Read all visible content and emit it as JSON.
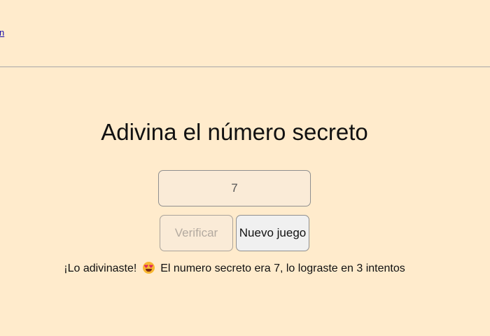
{
  "header": {
    "link_label": "n"
  },
  "main": {
    "title": "Adivina el número secreto",
    "input": {
      "value": "7",
      "placeholder": ""
    },
    "buttons": {
      "verify_label": "Verificar",
      "new_game_label": "Nuevo juego"
    },
    "result": {
      "prefix": "¡Lo adivinaste!",
      "emoji": "star-struck-face-icon",
      "suffix": "El numero secreto era 7, lo lograste en 3 intentos"
    }
  },
  "colors": {
    "background": "#ffebcc",
    "input_background": "#faebd7",
    "button_background": "#f0f0f0"
  }
}
